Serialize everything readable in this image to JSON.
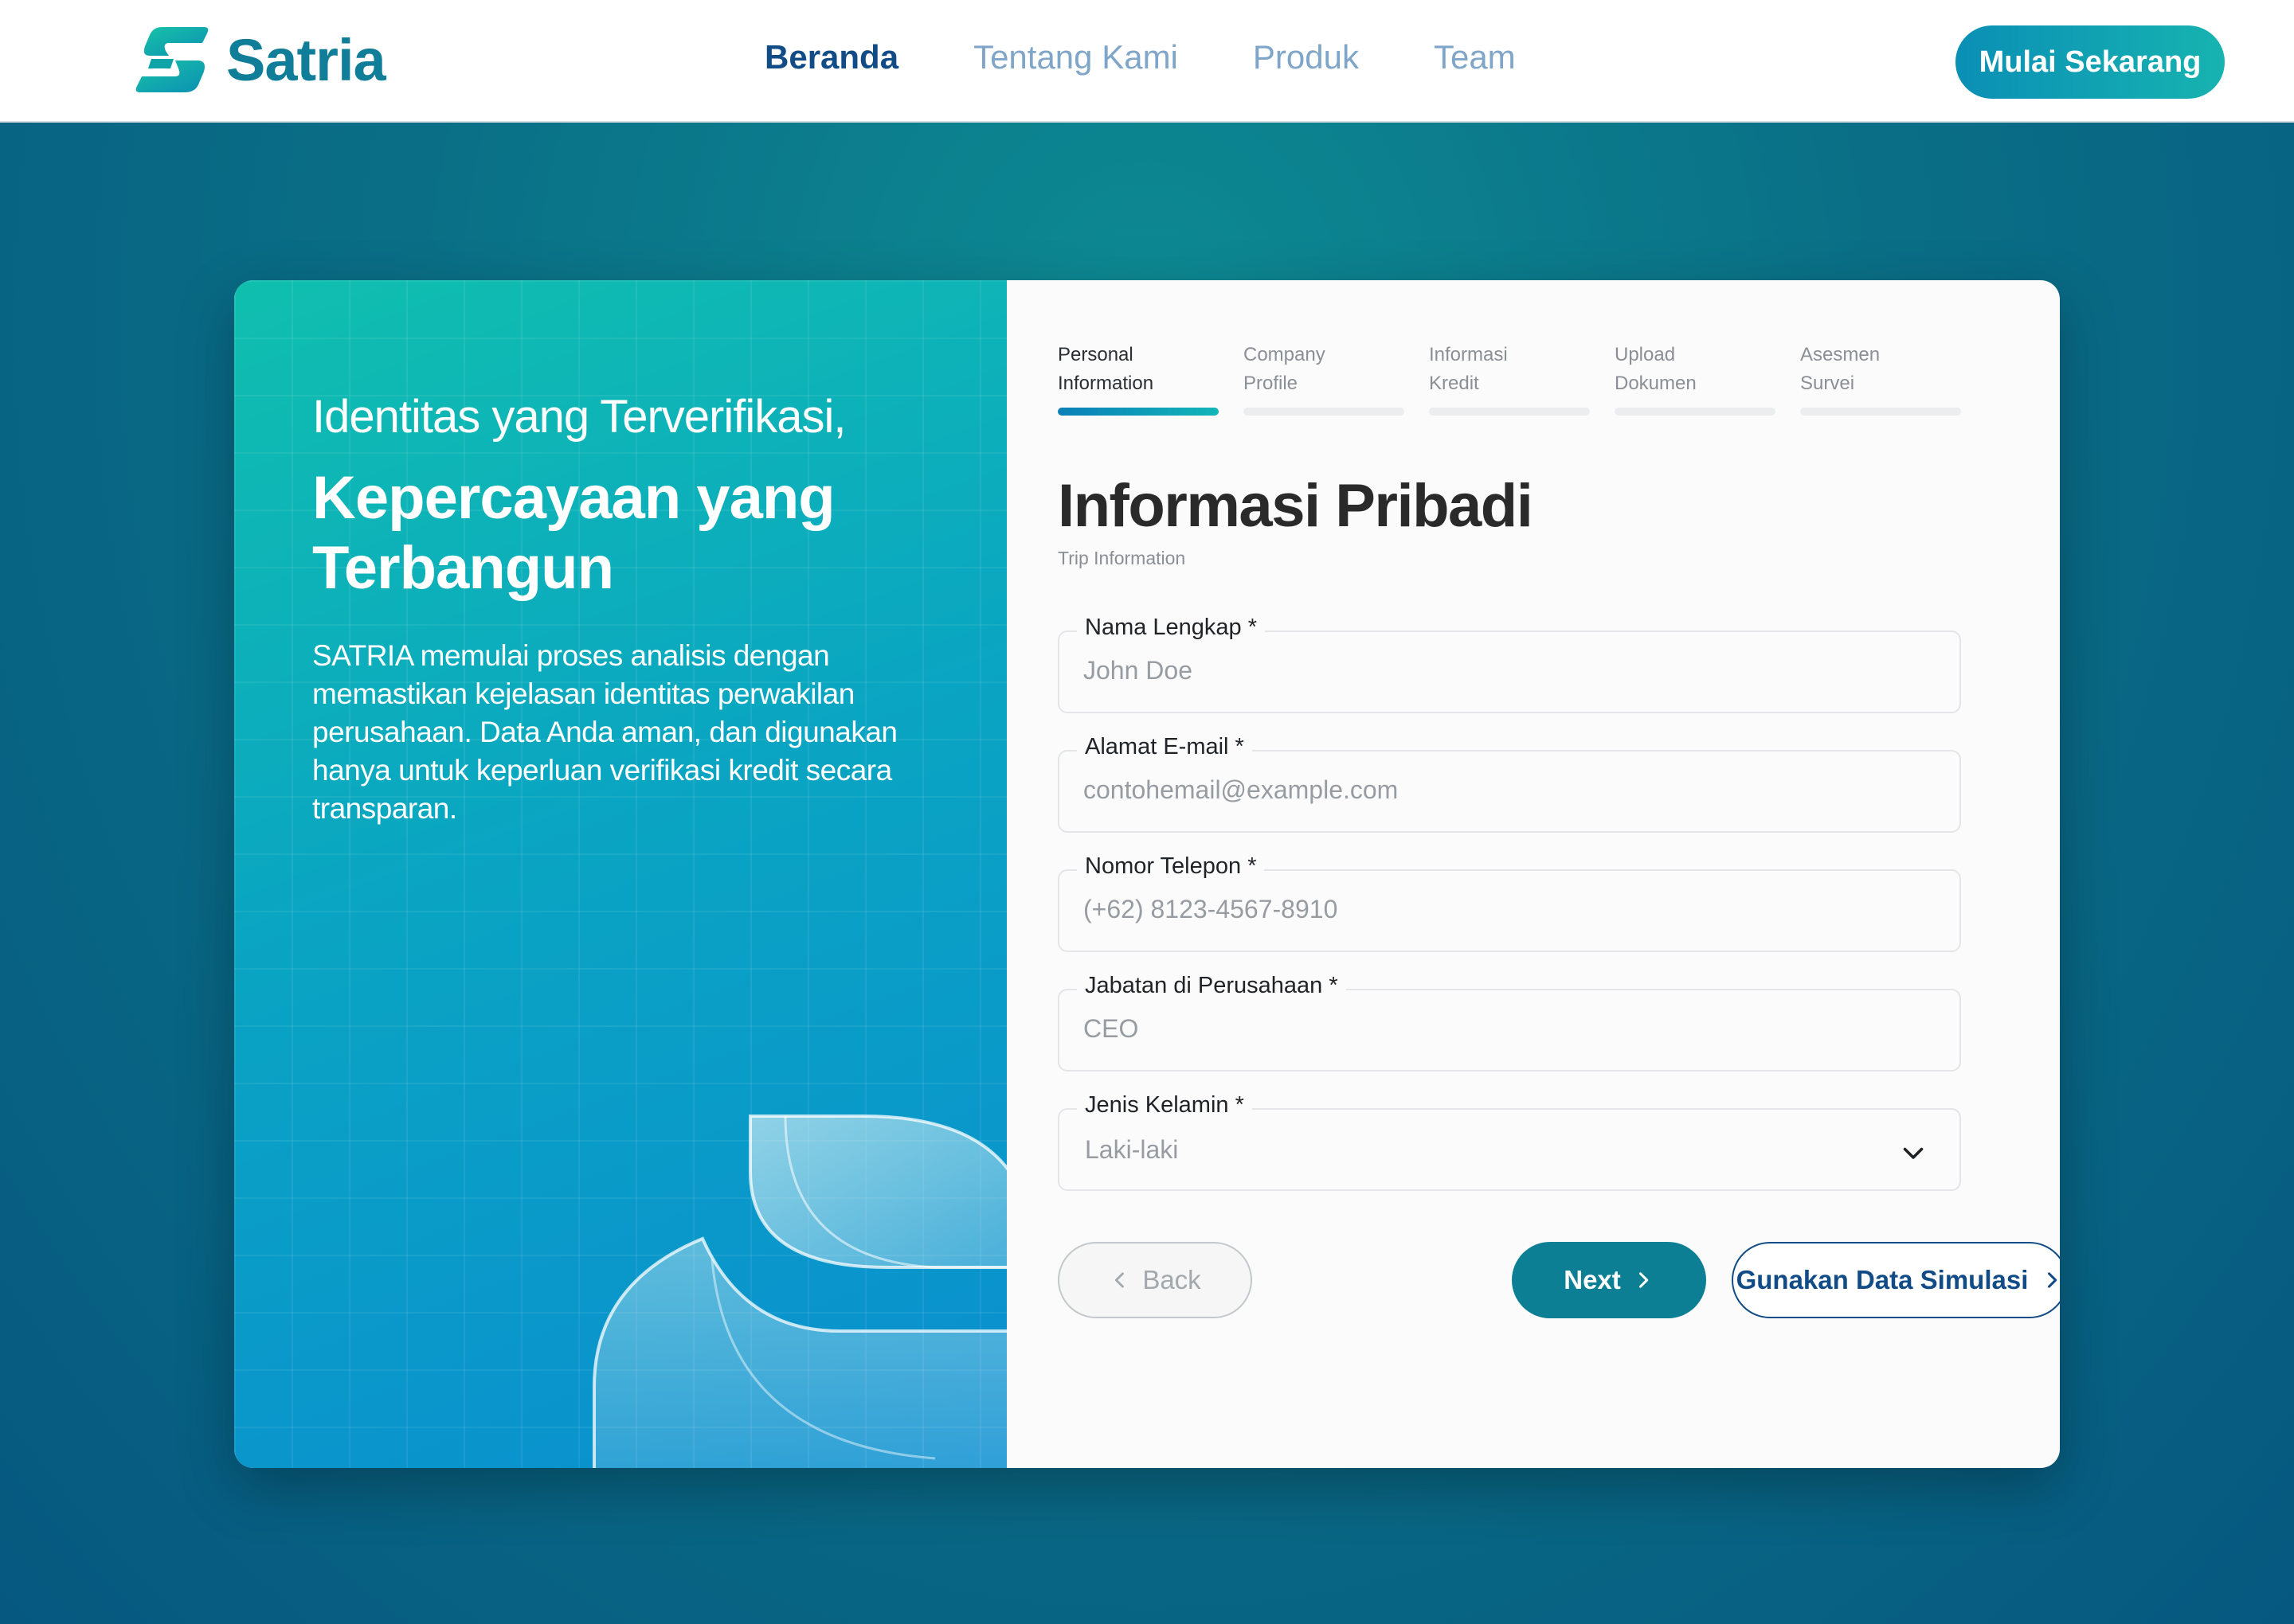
{
  "brand": {
    "name": "Satria"
  },
  "nav": {
    "links": [
      {
        "label": "Beranda",
        "active": true
      },
      {
        "label": "Tentang Kami",
        "active": false
      },
      {
        "label": "Produk",
        "active": false
      },
      {
        "label": "Team",
        "active": false
      }
    ],
    "cta_label": "Mulai Sekarang"
  },
  "hero": {
    "subtitle": "Identitas yang Terverifikasi,",
    "title": "Kepercayaan yang Terbangun",
    "description": "SATRIA memulai proses analisis dengan memastikan kejelasan identitas perwakilan perusahaan. Data Anda aman, dan digunakan hanya untuk keperluan verifikasi kredit secara transparan."
  },
  "steps": [
    {
      "line1": "Personal",
      "line2": "Information",
      "active": true
    },
    {
      "line1": "Company",
      "line2": "Profile",
      "active": false
    },
    {
      "line1": "Informasi",
      "line2": "Kredit",
      "active": false
    },
    {
      "line1": "Upload",
      "line2": "Dokumen",
      "active": false
    },
    {
      "line1": "Asesmen",
      "line2": "Survei",
      "active": false
    }
  ],
  "form": {
    "title": "Informasi Pribadi",
    "subtitle": "Trip Information",
    "fields": {
      "name": {
        "label": "Nama Lengkap *",
        "placeholder": "John Doe"
      },
      "email": {
        "label": "Alamat E-mail *",
        "placeholder": "contohemail@example.com"
      },
      "phone": {
        "label": "Nomor Telepon *",
        "placeholder": "(+62) 8123-4567-8910"
      },
      "position": {
        "label": "Jabatan di Perusahaan *",
        "placeholder": "CEO"
      },
      "gender": {
        "label": "Jenis Kelamin *",
        "value": "Laki-laki"
      }
    },
    "buttons": {
      "back": "Back",
      "next": "Next",
      "simulate": "Gunakan Data Simulasi"
    }
  },
  "colors": {
    "brand": "#107e99",
    "nav_active": "#124c86",
    "nav_inactive": "#7fa6c9",
    "next_button": "#0c7f95"
  }
}
